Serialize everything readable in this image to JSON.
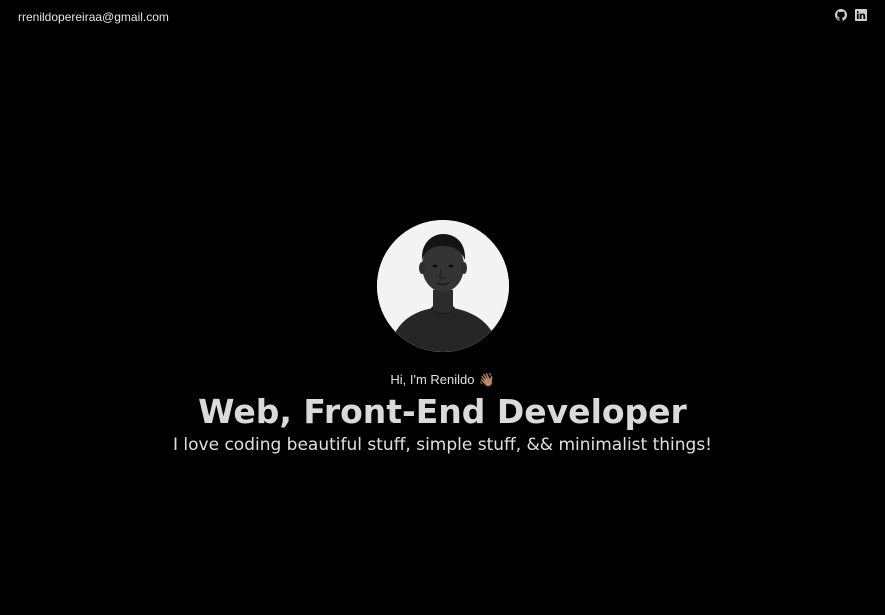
{
  "header": {
    "email": "rrenildopereiraa@gmail.com",
    "social": [
      {
        "name": "github-icon"
      },
      {
        "name": "linkedin-icon"
      }
    ]
  },
  "hero": {
    "avatar_icon": "profile-photo",
    "greeting": "Hi, I'm Renildo",
    "greeting_emoji": "👋🏽",
    "headline": "Web, Front-End Developer",
    "tagline": "I love coding beautiful stuff, simple stuff, && minimalist things!"
  },
  "colors": {
    "background": "#000000",
    "text": "#dcdcdc"
  }
}
